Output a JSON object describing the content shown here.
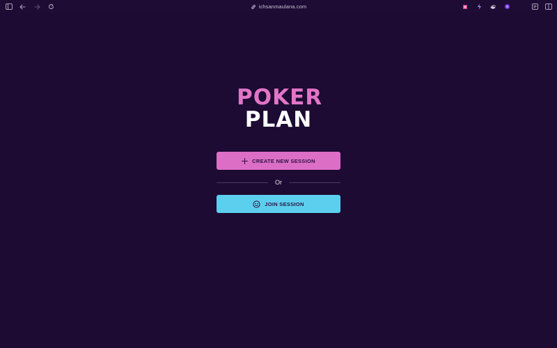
{
  "browser": {
    "url": "ichsanmaulana.com"
  },
  "icons": {
    "sidebar": "sidebar-toggle-icon",
    "back": "arrow-left-icon",
    "forward": "arrow-right-icon",
    "reload": "reload-icon",
    "link": "link-icon",
    "ext1": "extension-pink-icon",
    "ext2": "extension-bolt-icon",
    "ext3": "extension-stack-icon",
    "ext4": "extension-purple-icon",
    "reader": "reader-icon",
    "tabs": "split-view-icon",
    "plus": "plus-icon",
    "smile": "smile-icon"
  },
  "logo": {
    "line1": "POKER",
    "line2": "PLAN"
  },
  "actions": {
    "create_label": "CREATE NEW SESSION",
    "divider_text": "Or",
    "join_label": "JOIN SESSION"
  },
  "colors": {
    "background": "#1d0b33",
    "create_button": "#dc6ec6",
    "join_button": "#5ccfee",
    "logo_pink": "#e175c8"
  }
}
